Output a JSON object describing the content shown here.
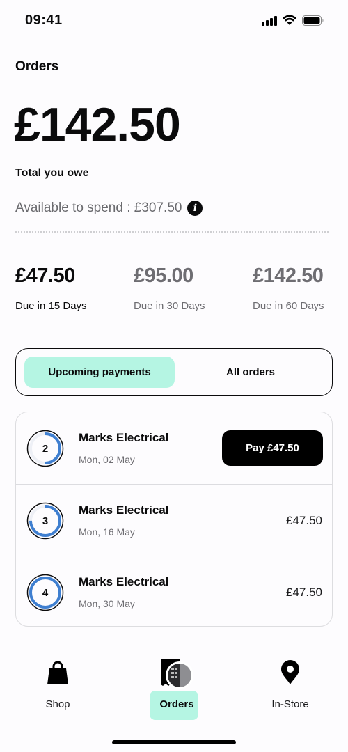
{
  "status_bar": {
    "time": "09:41",
    "icons": [
      "cellular-signal-icon",
      "wifi-icon",
      "battery-icon"
    ]
  },
  "header": {
    "title": "Orders"
  },
  "summary": {
    "total_amount": "£142.50",
    "total_label": "Total you owe",
    "available_label": "Available to spend : £307.50",
    "info_icon": "info-icon",
    "info_glyph": "i"
  },
  "due_schedule": [
    {
      "amount": "£47.50",
      "label": "Due in 15 Days",
      "active": true
    },
    {
      "amount": "£95.00",
      "label": "Due in 30 Days",
      "active": false
    },
    {
      "amount": "£142.50",
      "label": "Due in 60 Days",
      "active": false
    }
  ],
  "tabs": [
    {
      "label": "Upcoming payments",
      "selected": true
    },
    {
      "label": "All orders",
      "selected": false
    }
  ],
  "orders": [
    {
      "installment": "2",
      "merchant": "Marks Electrical",
      "date": "Mon, 02 May",
      "action_label": "Pay £47.50",
      "amount": null,
      "progress": 0.5
    },
    {
      "installment": "3",
      "merchant": "Marks Electrical",
      "date": "Mon, 16 May",
      "action_label": null,
      "amount": "£47.50",
      "progress": 0.75
    },
    {
      "installment": "4",
      "merchant": "Marks Electrical",
      "date": "Mon, 30 May",
      "action_label": null,
      "amount": "£47.50",
      "progress": 1.0
    }
  ],
  "bottom_nav": [
    {
      "label": "Shop",
      "icon": "shopping-bag-icon",
      "active": false
    },
    {
      "label": "Orders",
      "icon": "receipt-icon",
      "active": true
    },
    {
      "label": "In-Store",
      "icon": "location-pin-icon",
      "active": false
    }
  ],
  "colors": {
    "accent_mint": "#b5f5e3",
    "progress_blue": "#3f7fd0",
    "text_primary": "#0b0b0c",
    "text_secondary": "#6e6d72"
  }
}
